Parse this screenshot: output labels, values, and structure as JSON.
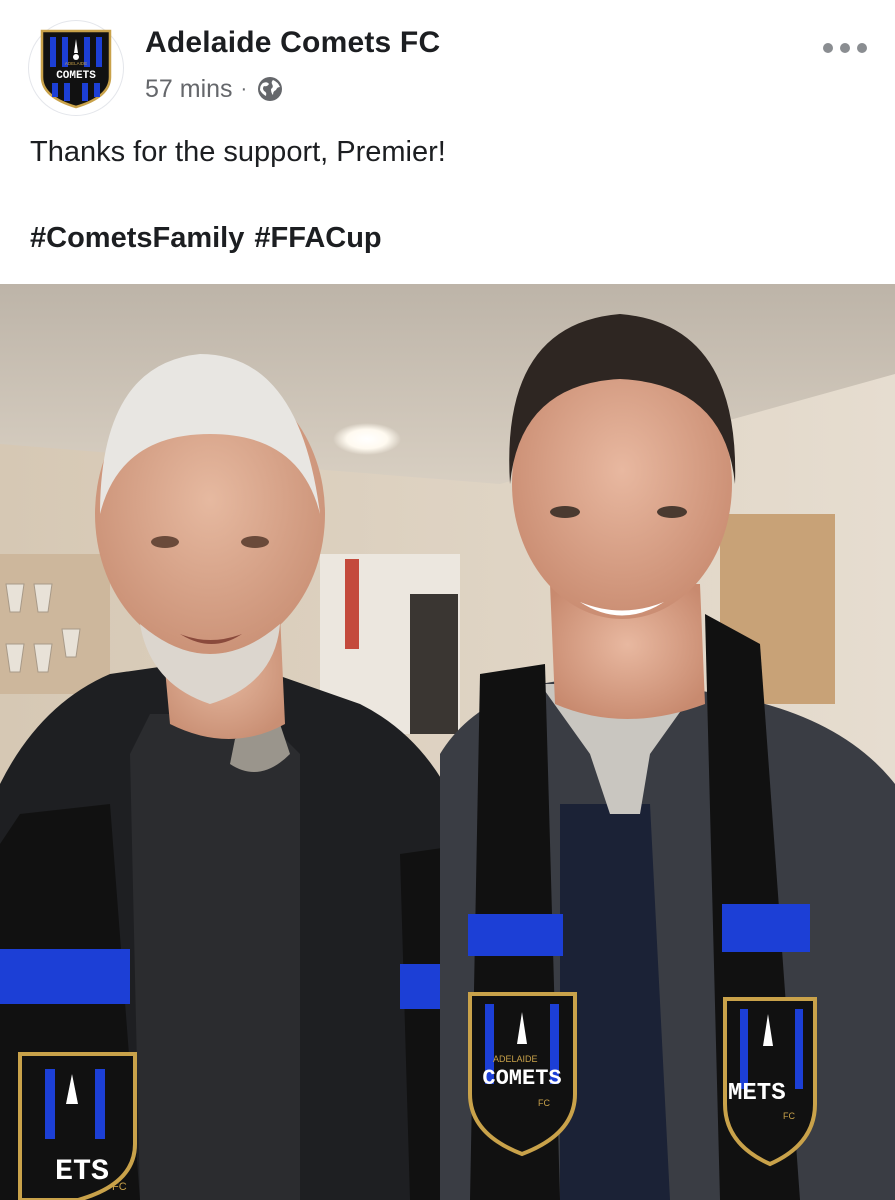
{
  "post": {
    "page_name": "Adelaide Comets FC",
    "timestamp": "57 mins",
    "separator": "·",
    "privacy_icon": "globe-icon",
    "more_icon": "more-options-icon",
    "body_text": "Thanks for the support, Premier!",
    "hashtags": [
      "#CometsFamily",
      "#FFACup"
    ]
  },
  "avatar": {
    "logo_icon": "comets-crest-logo",
    "logo_text": "COMETS",
    "logo_small_text": "ADELAIDE"
  },
  "photo": {
    "scarf_badge_left": "ETS",
    "scarf_badge_left_small": "FC",
    "scarf_badge_middle_small": "ADELAIDE",
    "scarf_badge_middle": "COMETS",
    "scarf_badge_middle_fc": "FC",
    "scarf_badge_right": "METS",
    "scarf_badge_right_small": "FC"
  },
  "colors": {
    "text_primary": "#1c1e21",
    "text_secondary": "#65676b",
    "club_blue": "#1c3fd6",
    "club_black": "#111111",
    "club_gold": "#c9a24a"
  }
}
